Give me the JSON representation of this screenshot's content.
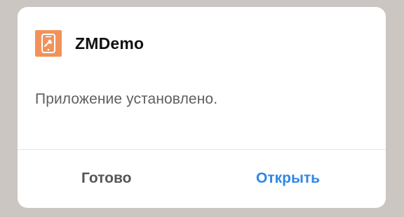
{
  "dialog": {
    "app_icon": "phone-wrench-icon",
    "app_name": "ZMDemo",
    "message": "Приложение установлено.",
    "buttons": {
      "done_label": "Готово",
      "open_label": "Открыть"
    }
  },
  "colors": {
    "icon_bg": "#f1925a",
    "accent": "#2f86e8",
    "overlay": "#cbc6c2"
  }
}
